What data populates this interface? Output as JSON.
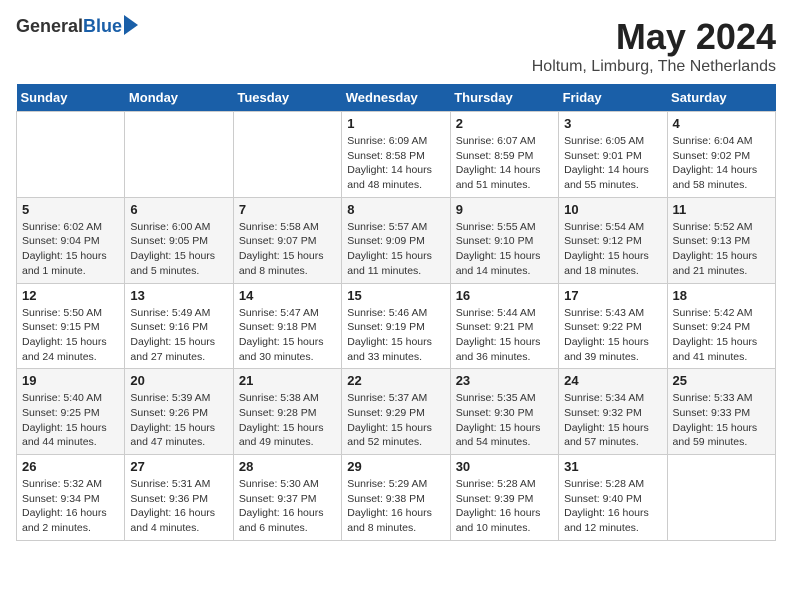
{
  "logo": {
    "general": "General",
    "blue": "Blue"
  },
  "title": "May 2024",
  "location": "Holtum, Limburg, The Netherlands",
  "days_of_week": [
    "Sunday",
    "Monday",
    "Tuesday",
    "Wednesday",
    "Thursday",
    "Friday",
    "Saturday"
  ],
  "weeks": [
    [
      {
        "day": "",
        "info": ""
      },
      {
        "day": "",
        "info": ""
      },
      {
        "day": "",
        "info": ""
      },
      {
        "day": "1",
        "info": "Sunrise: 6:09 AM\nSunset: 8:58 PM\nDaylight: 14 hours\nand 48 minutes."
      },
      {
        "day": "2",
        "info": "Sunrise: 6:07 AM\nSunset: 8:59 PM\nDaylight: 14 hours\nand 51 minutes."
      },
      {
        "day": "3",
        "info": "Sunrise: 6:05 AM\nSunset: 9:01 PM\nDaylight: 14 hours\nand 55 minutes."
      },
      {
        "day": "4",
        "info": "Sunrise: 6:04 AM\nSunset: 9:02 PM\nDaylight: 14 hours\nand 58 minutes."
      }
    ],
    [
      {
        "day": "5",
        "info": "Sunrise: 6:02 AM\nSunset: 9:04 PM\nDaylight: 15 hours\nand 1 minute."
      },
      {
        "day": "6",
        "info": "Sunrise: 6:00 AM\nSunset: 9:05 PM\nDaylight: 15 hours\nand 5 minutes."
      },
      {
        "day": "7",
        "info": "Sunrise: 5:58 AM\nSunset: 9:07 PM\nDaylight: 15 hours\nand 8 minutes."
      },
      {
        "day": "8",
        "info": "Sunrise: 5:57 AM\nSunset: 9:09 PM\nDaylight: 15 hours\nand 11 minutes."
      },
      {
        "day": "9",
        "info": "Sunrise: 5:55 AM\nSunset: 9:10 PM\nDaylight: 15 hours\nand 14 minutes."
      },
      {
        "day": "10",
        "info": "Sunrise: 5:54 AM\nSunset: 9:12 PM\nDaylight: 15 hours\nand 18 minutes."
      },
      {
        "day": "11",
        "info": "Sunrise: 5:52 AM\nSunset: 9:13 PM\nDaylight: 15 hours\nand 21 minutes."
      }
    ],
    [
      {
        "day": "12",
        "info": "Sunrise: 5:50 AM\nSunset: 9:15 PM\nDaylight: 15 hours\nand 24 minutes."
      },
      {
        "day": "13",
        "info": "Sunrise: 5:49 AM\nSunset: 9:16 PM\nDaylight: 15 hours\nand 27 minutes."
      },
      {
        "day": "14",
        "info": "Sunrise: 5:47 AM\nSunset: 9:18 PM\nDaylight: 15 hours\nand 30 minutes."
      },
      {
        "day": "15",
        "info": "Sunrise: 5:46 AM\nSunset: 9:19 PM\nDaylight: 15 hours\nand 33 minutes."
      },
      {
        "day": "16",
        "info": "Sunrise: 5:44 AM\nSunset: 9:21 PM\nDaylight: 15 hours\nand 36 minutes."
      },
      {
        "day": "17",
        "info": "Sunrise: 5:43 AM\nSunset: 9:22 PM\nDaylight: 15 hours\nand 39 minutes."
      },
      {
        "day": "18",
        "info": "Sunrise: 5:42 AM\nSunset: 9:24 PM\nDaylight: 15 hours\nand 41 minutes."
      }
    ],
    [
      {
        "day": "19",
        "info": "Sunrise: 5:40 AM\nSunset: 9:25 PM\nDaylight: 15 hours\nand 44 minutes."
      },
      {
        "day": "20",
        "info": "Sunrise: 5:39 AM\nSunset: 9:26 PM\nDaylight: 15 hours\nand 47 minutes."
      },
      {
        "day": "21",
        "info": "Sunrise: 5:38 AM\nSunset: 9:28 PM\nDaylight: 15 hours\nand 49 minutes."
      },
      {
        "day": "22",
        "info": "Sunrise: 5:37 AM\nSunset: 9:29 PM\nDaylight: 15 hours\nand 52 minutes."
      },
      {
        "day": "23",
        "info": "Sunrise: 5:35 AM\nSunset: 9:30 PM\nDaylight: 15 hours\nand 54 minutes."
      },
      {
        "day": "24",
        "info": "Sunrise: 5:34 AM\nSunset: 9:32 PM\nDaylight: 15 hours\nand 57 minutes."
      },
      {
        "day": "25",
        "info": "Sunrise: 5:33 AM\nSunset: 9:33 PM\nDaylight: 15 hours\nand 59 minutes."
      }
    ],
    [
      {
        "day": "26",
        "info": "Sunrise: 5:32 AM\nSunset: 9:34 PM\nDaylight: 16 hours\nand 2 minutes."
      },
      {
        "day": "27",
        "info": "Sunrise: 5:31 AM\nSunset: 9:36 PM\nDaylight: 16 hours\nand 4 minutes."
      },
      {
        "day": "28",
        "info": "Sunrise: 5:30 AM\nSunset: 9:37 PM\nDaylight: 16 hours\nand 6 minutes."
      },
      {
        "day": "29",
        "info": "Sunrise: 5:29 AM\nSunset: 9:38 PM\nDaylight: 16 hours\nand 8 minutes."
      },
      {
        "day": "30",
        "info": "Sunrise: 5:28 AM\nSunset: 9:39 PM\nDaylight: 16 hours\nand 10 minutes."
      },
      {
        "day": "31",
        "info": "Sunrise: 5:28 AM\nSunset: 9:40 PM\nDaylight: 16 hours\nand 12 minutes."
      },
      {
        "day": "",
        "info": ""
      }
    ]
  ]
}
